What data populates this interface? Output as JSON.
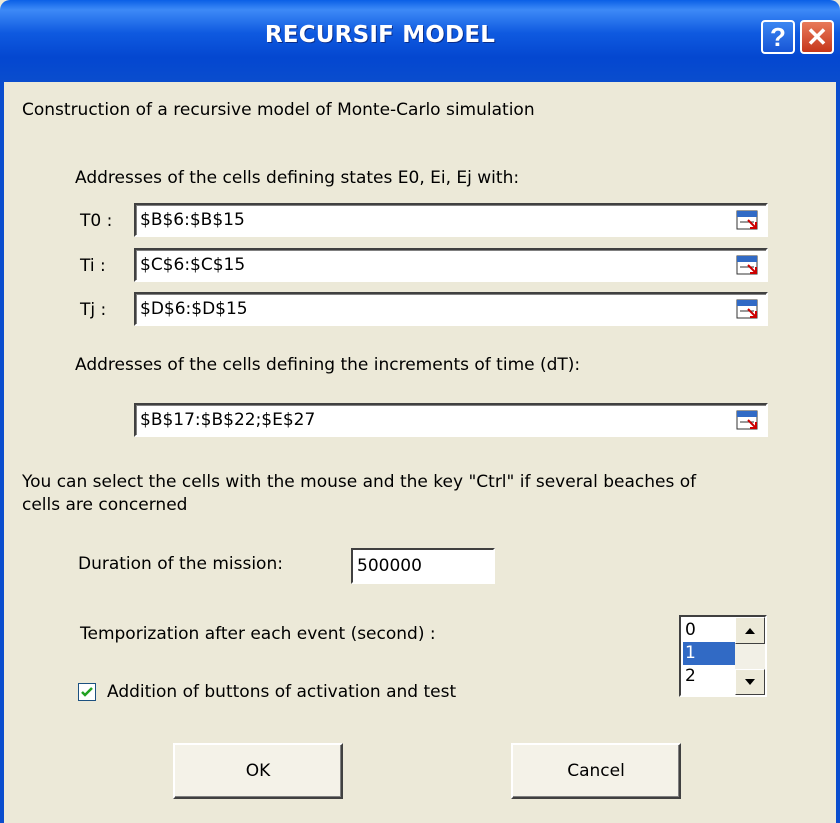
{
  "window": {
    "title": "RECURSIF MODEL",
    "help_label": "?",
    "close_label": "✕"
  },
  "intro": "Construction of a recursive model of Monte-Carlo simulation",
  "states": {
    "heading": "Addresses of the cells defining states E0, Ei, Ej with:",
    "fields": [
      {
        "label": "T0 :",
        "value": "$B$6:$B$15"
      },
      {
        "label": "Ti :",
        "value": "$C$6:$C$15"
      },
      {
        "label": "Tj :",
        "value": "$D$6:$D$15"
      }
    ]
  },
  "increments": {
    "heading": "Addresses of the cells defining the increments of time (dT):",
    "value": "$B$17:$B$22;$E$27"
  },
  "hint_line1": "You can select the cells with the mouse and the key \"Ctrl\" if several beaches of",
  "hint_line2": "cells are concerned",
  "duration": {
    "label": "Duration of the mission:",
    "value": "500000"
  },
  "temporization": {
    "label": "Temporization after each event (second) :",
    "options": [
      "0",
      "1",
      "2"
    ],
    "selected": "1"
  },
  "buttons_checkbox": {
    "label": "Addition of buttons of activation and test",
    "checked": true
  },
  "ok_label": "OK",
  "cancel_label": "Cancel"
}
